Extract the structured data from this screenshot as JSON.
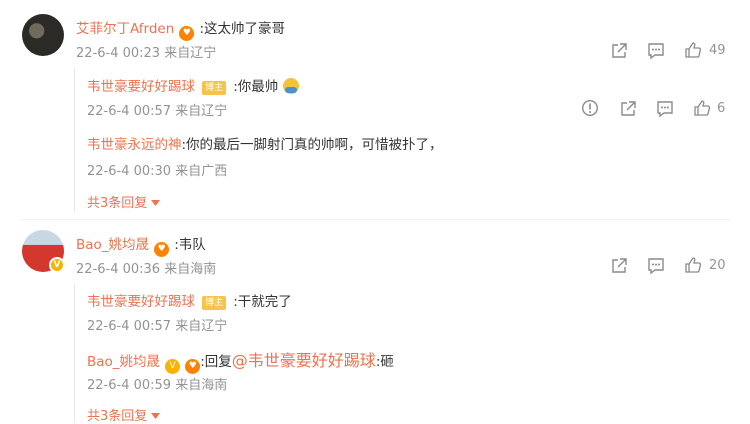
{
  "comments": [
    {
      "author": "艾菲尔丁Afrden",
      "content": ":这太帅了豪哥",
      "time": "22-6-4 00:23",
      "location": "来自辽宁",
      "likes": "49",
      "replies": [
        {
          "author": "韦世豪要好好踢球",
          "tag": "博主",
          "content": ":你最帅",
          "time": "22-6-4 00:57",
          "location": "来自辽宁",
          "likes": "6"
        },
        {
          "author": "韦世豪永远的神",
          "content": ":你的最后一脚射门真的帅啊，可惜被扑了，",
          "time": "22-6-4 00:30",
          "location": "来自广西"
        }
      ],
      "more": "共3条回复"
    },
    {
      "author": "Bao_姚均晟",
      "content": ":韦队",
      "time": "22-6-4 00:36",
      "location": "来自海南",
      "likes": "20",
      "replies": [
        {
          "author": "韦世豪要好好踢球",
          "tag": "博主",
          "content": ":干就完了",
          "time": "22-6-4 00:57",
          "location": "来自辽宁"
        },
        {
          "author": "Bao_姚均晟",
          "content_prefix": ":回复",
          "mention": "@韦世豪要好好踢球",
          "content": ":砸",
          "time": "22-6-4 00:59",
          "location": "来自海南"
        }
      ],
      "more": "共3条回复"
    }
  ],
  "icons": {
    "share": "share-icon",
    "comment": "comment-icon",
    "like": "thumbs-up-icon",
    "report": "report-icon",
    "fan_badge": "fan-badge-icon",
    "verified": "verified-badge-icon",
    "chevron": "chevron-down-icon"
  },
  "colors": {
    "username": "#eb7350",
    "meta": "#939393",
    "author_tag": "#f8c34a"
  }
}
